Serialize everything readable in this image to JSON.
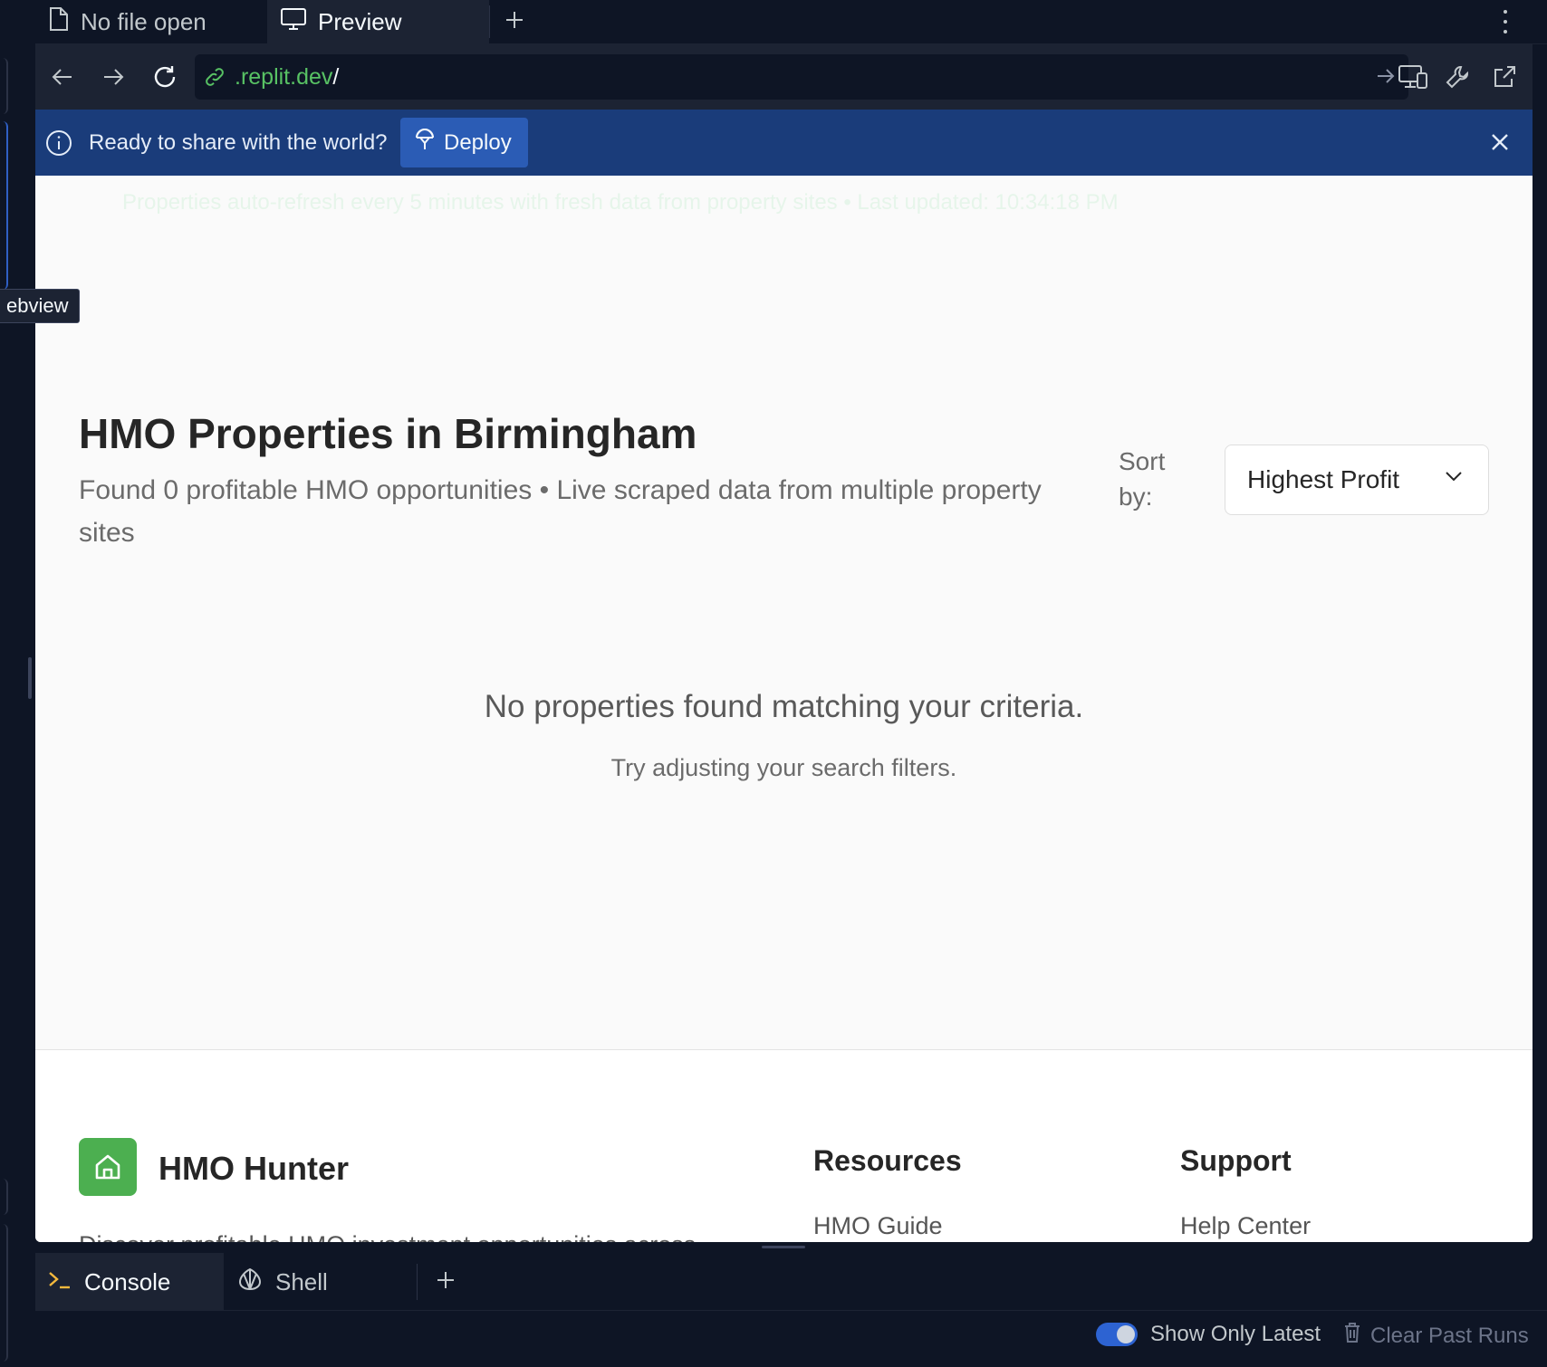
{
  "tooltip": {
    "text": "ebview"
  },
  "tabs": [
    {
      "label": "No file open",
      "icon": "file-icon"
    },
    {
      "label": "Preview",
      "icon": "monitor-icon"
    }
  ],
  "url": {
    "domain": ".replit.dev",
    "path": "/"
  },
  "banner": {
    "message": "Ready to share with the world?",
    "deploy_label": "Deploy"
  },
  "page": {
    "refresh_note": "Properties auto-refresh every 5 minutes with fresh data from property sites • Last updated: 10:34:18 PM",
    "title": "HMO Properties in Birmingham",
    "subtitle": "Found 0 profitable HMO opportunities • Live scraped data from multiple property sites",
    "sort_label": "Sort by:",
    "sort_value": "Highest Profit",
    "empty_title": "No properties found matching your criteria.",
    "empty_sub": "Try adjusting your search filters."
  },
  "footer": {
    "brand": "HMO Hunter",
    "description": "Discover profitable HMO investment opportunities across",
    "resources_heading": "Resources",
    "resources_link": "HMO Guide",
    "support_heading": "Support",
    "support_link": "Help Center"
  },
  "console": {
    "tabs": [
      {
        "label": "Console"
      },
      {
        "label": "Shell"
      }
    ],
    "show_latest_label": "Show Only Latest",
    "show_latest": true,
    "clear_label": "Clear Past Runs"
  },
  "colors": {
    "ide_bg": "#0e1525",
    "banner_bg": "#1a3c7a",
    "deploy_button": "#2b5cb5",
    "url_green": "#58c264",
    "brand_green": "#4caf50",
    "toggle_blue": "#2d63d2"
  }
}
